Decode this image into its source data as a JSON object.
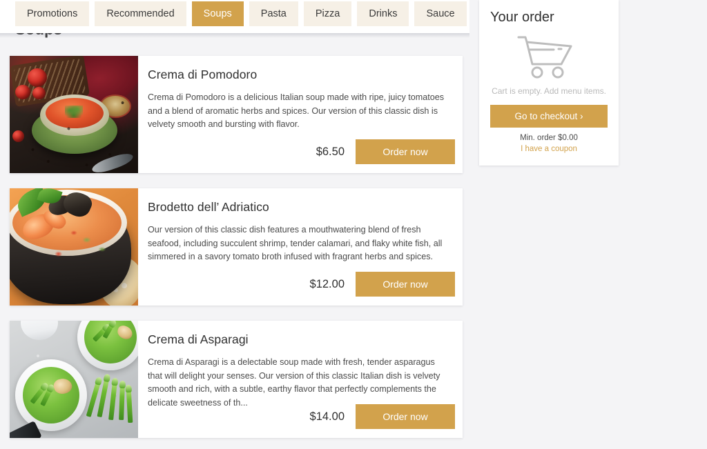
{
  "nav": {
    "tabs": [
      {
        "label": "Promotions",
        "active": false
      },
      {
        "label": "Recommended",
        "active": false
      },
      {
        "label": "Soups",
        "active": true
      },
      {
        "label": "Pasta",
        "active": false
      },
      {
        "label": "Pizza",
        "active": false
      },
      {
        "label": "Drinks",
        "active": false
      },
      {
        "label": "Sauce",
        "active": false
      }
    ]
  },
  "section": {
    "heading": "Soups"
  },
  "menu": {
    "order_button_label": "Order now",
    "items": [
      {
        "title": "Crema di Pomodoro",
        "description": "Crema di Pomodoro is a delicious Italian soup made with ripe, juicy tomatoes and a blend of aromatic herbs and spices. Our version of this classic dish is velvety smooth and bursting with flavor.",
        "price": "$6.50",
        "photo": "tomato-soup-photo"
      },
      {
        "title": "Brodetto dell’ Adriatico",
        "description": "Our version of this classic dish features a mouthwatering blend of fresh seafood, including succulent shrimp, tender calamari, and flaky white fish, all simmered in a savory tomato broth infused with fragrant herbs and spices.",
        "price": "$12.00",
        "photo": "seafood-stew-photo"
      },
      {
        "title": "Crema di Asparagi",
        "description": "Crema di Asparagi is a delectable soup made with fresh, tender asparagus that will delight your senses. Our version of this classic Italian dish is velvety smooth and rich, with a subtle, earthy flavor that perfectly complements the delicate sweetness of th...",
        "price": "$14.00",
        "photo": "asparagus-soup-photo"
      }
    ]
  },
  "order_panel": {
    "title": "Your order",
    "cart_icon": "shopping-cart-icon",
    "empty_message": "Cart is empty. Add menu items.",
    "checkout_label": "Go to checkout ›",
    "min_order": "Min. order $0.00",
    "coupon_label": "I have a coupon"
  },
  "colors": {
    "accent": "#d2a24c",
    "tab_inactive_bg": "#f6f0e6",
    "page_bg": "#f4f4f6",
    "card_bg": "#ffffff",
    "muted_text": "#b9b9b9"
  }
}
